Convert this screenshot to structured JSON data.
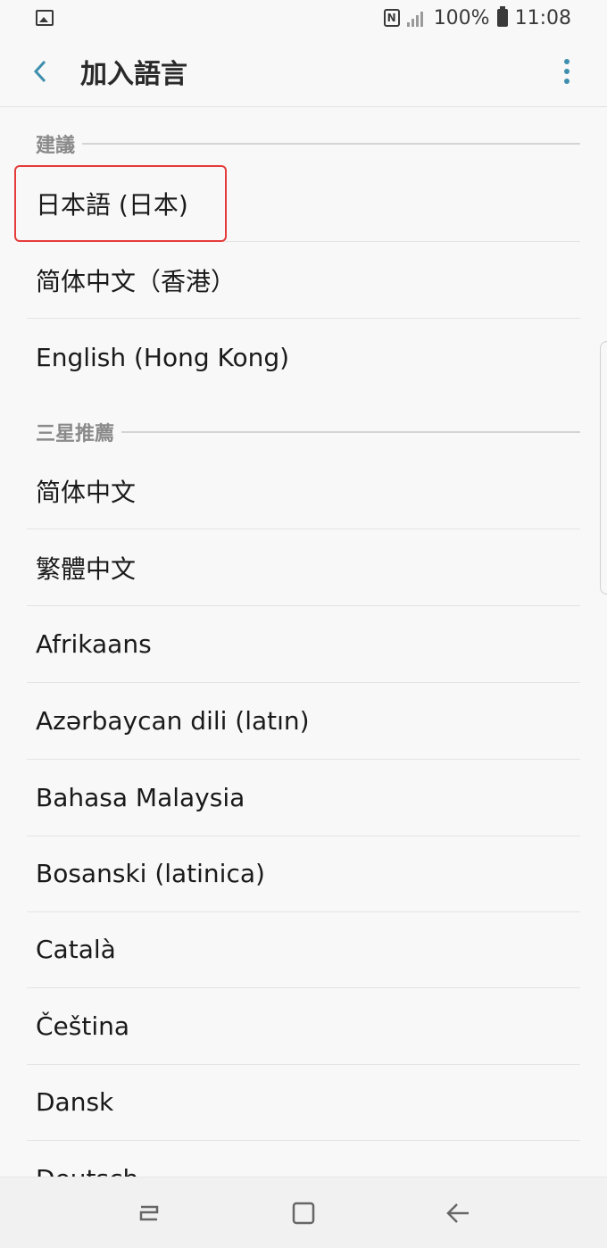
{
  "status_bar": {
    "battery": "100%",
    "time": "11:08",
    "icons": [
      "image-icon",
      "nfc-icon",
      "signal-icon",
      "battery-icon"
    ]
  },
  "app_bar": {
    "title": "加入語言",
    "back_icon": "chevron-left-icon",
    "menu_icon": "more-vertical-icon"
  },
  "sections": [
    {
      "label": "建議",
      "items": [
        "日本語 (日本)",
        "简体中文（香港）",
        "English (Hong Kong)"
      ]
    },
    {
      "label": "三星推薦",
      "items": [
        "简体中文",
        "繁體中文",
        "Afrikaans",
        "Azərbaycan dili (latın)",
        "Bahasa Malaysia",
        "Bosanski (latinica)",
        "Català",
        "Čeština",
        "Dansk",
        "Deutsch"
      ]
    }
  ],
  "highlighted_item": "日本語 (日本)",
  "colors": {
    "accent": "#3e8fae",
    "highlight": "#e53b3b",
    "background": "#f8f8f8"
  },
  "nav_bar": {
    "icons": [
      "recents-icon",
      "home-icon",
      "back-arrow-icon"
    ]
  }
}
